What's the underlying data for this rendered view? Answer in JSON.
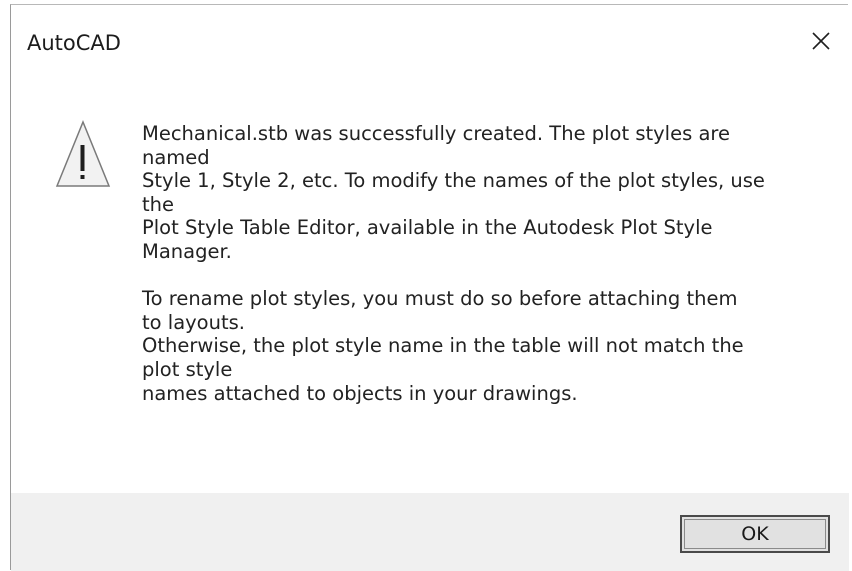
{
  "window": {
    "title": "AutoCAD",
    "close_icon": "close-icon"
  },
  "message": {
    "icon": "warning-icon",
    "lines": [
      "Mechanical.stb was successfully created.  The plot styles are",
      "named",
      "Style 1, Style 2, etc.  To modify the names of the plot styles, use",
      "the",
      "Plot Style Table Editor, available in the Autodesk Plot Style",
      "Manager.",
      "",
      "To rename plot styles, you must do so before attaching them",
      "to layouts.",
      "Otherwise, the plot style name in the table will not match the",
      "plot style",
      "names attached to objects in your drawings."
    ]
  },
  "buttons": {
    "ok_label": "OK"
  },
  "colors": {
    "footer_background": "#f0f0f0",
    "warning_fill": "#f2f2f2",
    "warning_stroke": "#7a7a7a"
  }
}
